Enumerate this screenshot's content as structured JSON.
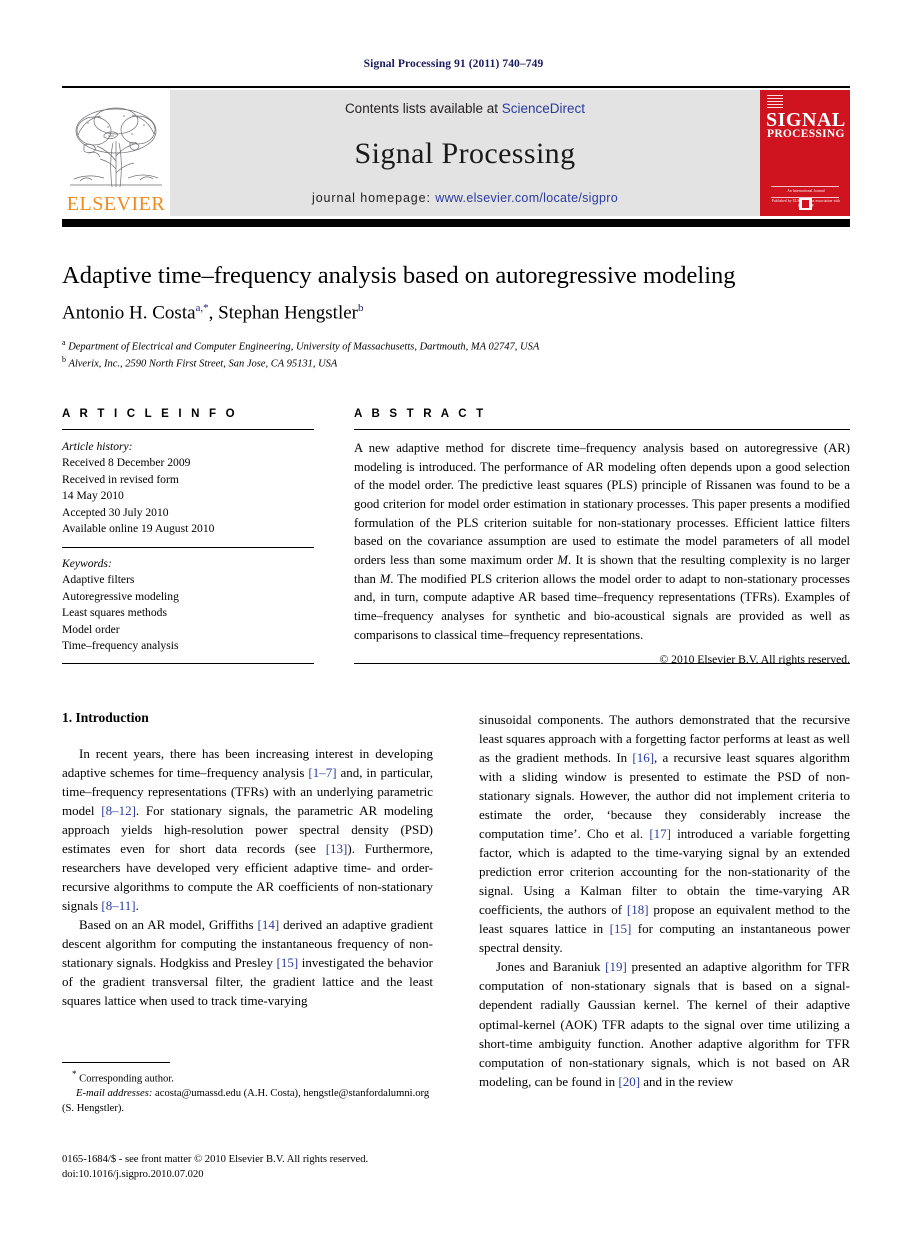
{
  "running_head": "Signal Processing 91 (2011) 740–749",
  "masthead": {
    "contents_prefix": "Contents lists available at ",
    "sciencedirect": "ScienceDirect",
    "journal_name": "Signal Processing",
    "homepage_prefix": "journal homepage: ",
    "homepage_url": "www.elsevier.com/locate/sigpro",
    "publisher_wordmark": "ELSEVIER",
    "cover": {
      "title_line1": "SIGNAL",
      "title_line2": "PROCESSING",
      "subtitle": "An International Journal",
      "imprint_note": "Published by ELSEVIER in association with EURASIP"
    },
    "colors": {
      "link_blue": "#2a3a9e",
      "banner_gray": "#e3e3e3",
      "cover_red": "#cf1420",
      "elsevier_orange": "#f08a1c"
    }
  },
  "article": {
    "title": "Adaptive time–frequency analysis based on autoregressive modeling",
    "authors_part1": "Antonio H. Costa",
    "authors_sup1": "a,*",
    "authors_part2": ", Stephan Hengstler",
    "authors_sup2": "b",
    "affiliations": [
      {
        "marker": "a",
        "text": "Department of Electrical and Computer Engineering, University of Massachusetts, Dartmouth, MA 02747, USA"
      },
      {
        "marker": "b",
        "text": "Alverix, Inc., 2590 North First Street, San Jose, CA 95131, USA"
      }
    ]
  },
  "article_info": {
    "heading": "A R T I C L E   I N F O",
    "history_label": "Article history:",
    "history": [
      "Received 8 December 2009",
      "Received in revised form",
      "14 May 2010",
      "Accepted 30 July 2010",
      "Available online 19 August 2010"
    ],
    "keywords_label": "Keywords:",
    "keywords": [
      "Adaptive filters",
      "Autoregressive modeling",
      "Least squares methods",
      "Model order",
      "Time–frequency analysis"
    ]
  },
  "abstract": {
    "heading": "A B S T R A C T",
    "text_1": "A new adaptive method for discrete time–frequency analysis based on autoregressive (AR) modeling is introduced. The performance of AR modeling often depends upon a good selection of the model order. The predictive least squares (PLS) principle of Rissanen was found to be a good criterion for model order estimation in stationary processes. This paper presents a modified formulation of the PLS criterion suitable for non-stationary processes. Efficient lattice filters based on the covariance assumption are used to estimate the model parameters of all model orders less than some maximum order ",
    "em_1": "M",
    "text_2": ". It is shown that the resulting complexity is no larger than ",
    "em_2": "M",
    "text_3": ". The modified PLS criterion allows the model order to adapt to non-stationary processes and, in turn, compute adaptive AR based time–frequency representations (TFRs). Examples of time–frequency analyses for synthetic and bio-acoustical signals are provided as well as comparisons to classical time–frequency representations.",
    "copyright": "© 2010 Elsevier B.V. All rights reserved."
  },
  "body": {
    "section_number_title": "1.  Introduction",
    "left_column": {
      "paragraph_1": {
        "s1": "In recent years, there has been increasing interest in developing adaptive schemes for time–frequency analysis ",
        "c1": "[1–7]",
        "s2": " and, in particular, time–frequency representations (TFRs) with an underlying parametric model ",
        "c2": "[8–12]",
        "s3": ". For stationary signals, the parametric AR modeling approach yields high-resolution power spectral density (PSD) estimates even for short data records (see ",
        "c3": "[13]",
        "s4": "). Furthermore, researchers have developed very efficient adaptive time- and order-recursive algorithms to compute the AR coefficients of non-stationary signals ",
        "c4": "[8–11]",
        "s5": "."
      },
      "paragraph_2": {
        "s1": "Based on an AR model, Griffiths ",
        "c1": "[14]",
        "s2": " derived an adaptive gradient descent algorithm for computing the instantaneous frequency of non-stationary signals. Hodgkiss and Presley ",
        "c2": "[15]",
        "s3": " investigated the behavior of the gradient transversal filter, the gradient lattice and the least squares lattice when used to track time-varying"
      }
    },
    "right_column": {
      "paragraph_1": {
        "s1": "sinusoidal components. The authors demonstrated that the recursive least squares approach with a forgetting factor performs at least as well as the gradient methods. In ",
        "c1": "[16]",
        "s2": ", a recursive least squares algorithm with a sliding window is presented to estimate the PSD of non-stationary signals. However, the author did not implement criteria to estimate the order, ‘because they considerably increase the computation time’. Cho et al. ",
        "c2": "[17]",
        "s3": " introduced a variable forgetting factor, which is adapted to the time-varying signal by an extended prediction error criterion accounting for the non-stationarity of the signal. Using a Kalman filter to obtain the time-varying AR coefficients, the authors of ",
        "c3": "[18]",
        "s4": " propose an equivalent method to the least squares lattice in ",
        "c4": "[15]",
        "s5": " for computing an instantaneous power spectral density."
      },
      "paragraph_2": {
        "s1": "Jones and Baraniuk ",
        "c1": "[19]",
        "s2": " presented an adaptive algorithm for TFR computation of non-stationary signals that is based on a signal-dependent radially Gaussian kernel. The kernel of their adaptive optimal-kernel (AOK) TFR adapts to the signal over time utilizing a short-time ambiguity function. Another adaptive algorithm for TFR computation of non-stationary signals, which is not based on AR modeling, can be found in ",
        "c2": "[20]",
        "s3": " and in the review"
      }
    }
  },
  "footnotes": {
    "corresponding_marker": "*",
    "corresponding_text": " Corresponding author.",
    "email_label": "E-mail addresses:",
    "email_text": " acosta@umassd.edu (A.H. Costa), hengstle@stanfordalumni.org (S. Hengstler).",
    "imprint_line1": "0165-1684/$ - see front matter © 2010 Elsevier B.V. All rights reserved.",
    "imprint_line2": "doi:10.1016/j.sigpro.2010.07.020"
  }
}
